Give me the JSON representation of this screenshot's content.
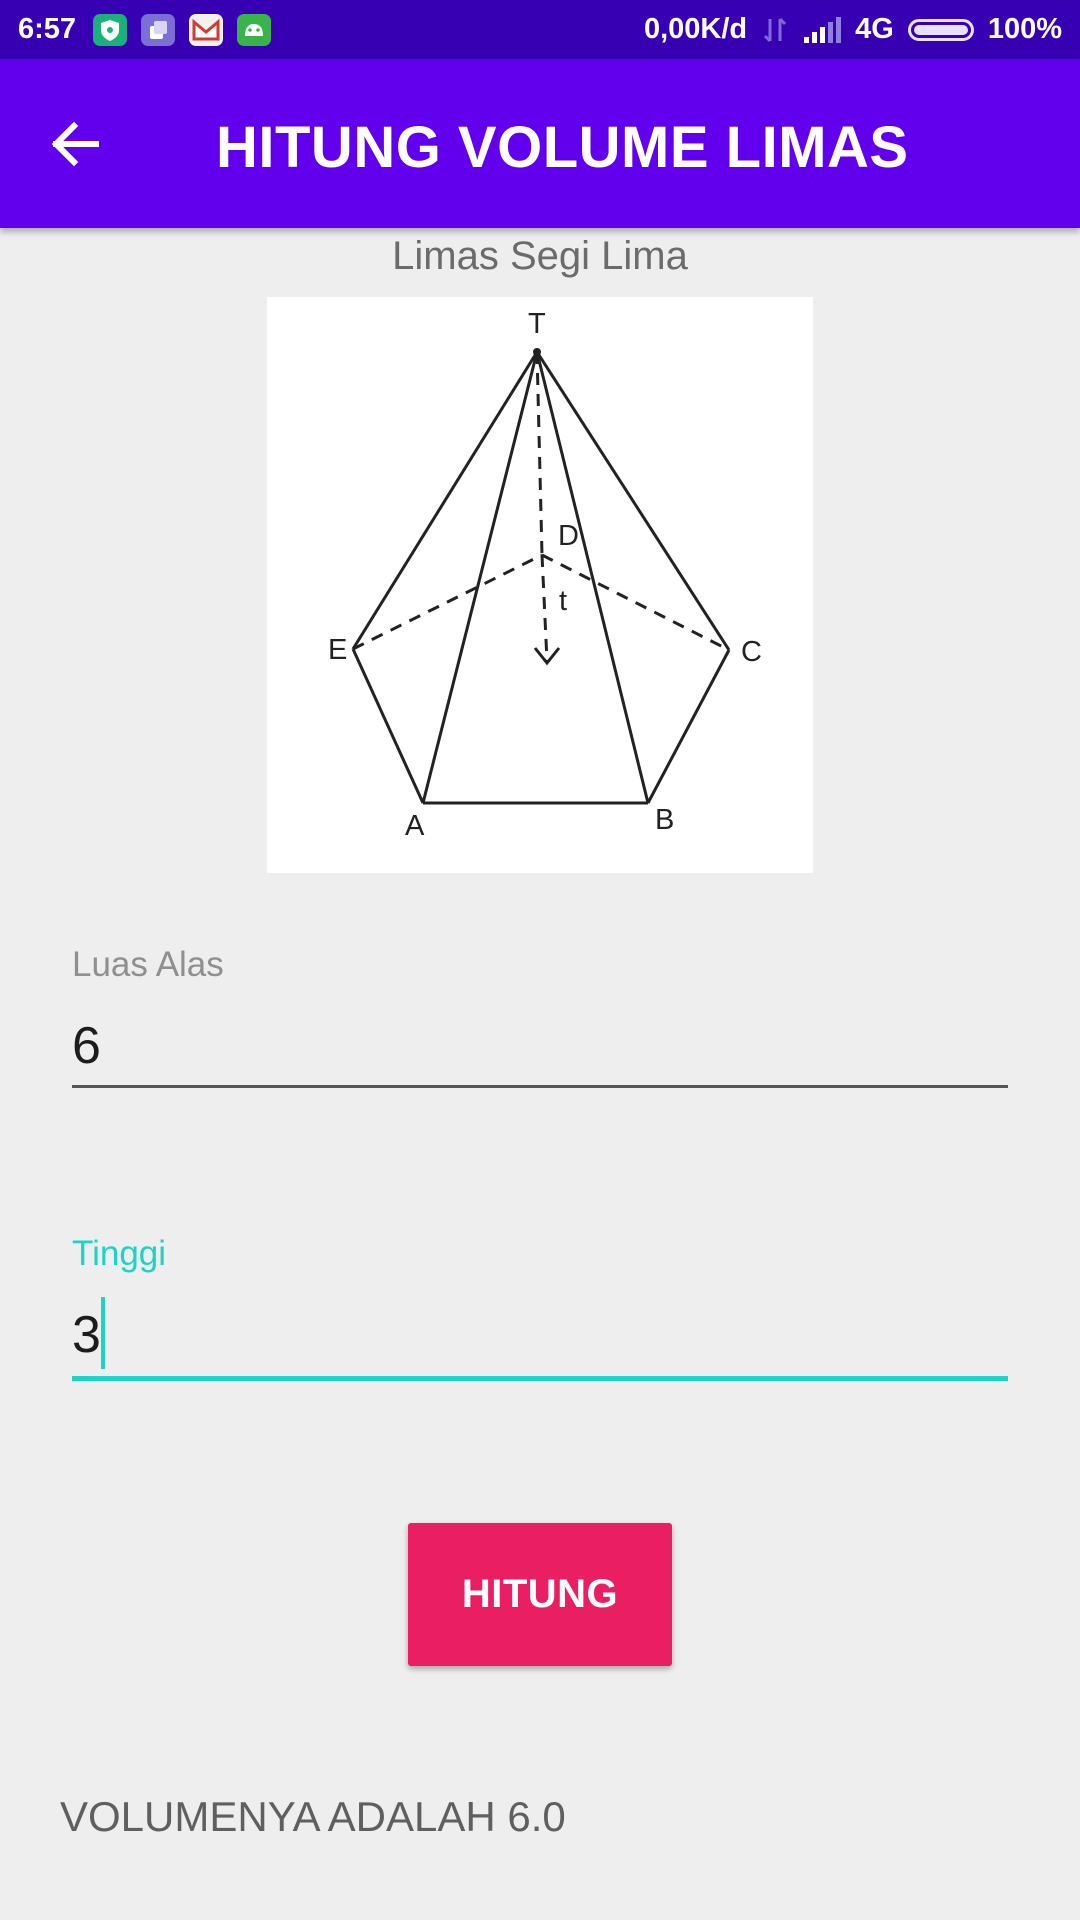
{
  "status_bar": {
    "time": "6:57",
    "network_speed": "0,00K/d",
    "network_type": "4G",
    "battery_text": "100%",
    "battery_level": 1.0,
    "notification_icons": [
      "shield-app-icon",
      "copy-app-icon",
      "gmail-icon",
      "android-icon"
    ]
  },
  "app_bar": {
    "title": "HITUNG VOLUME LIMAS",
    "back_icon": "arrow-left-icon"
  },
  "shape": {
    "label": "Limas Segi Lima",
    "diagram_points": {
      "apex": "T",
      "base_center": "D",
      "height": "t",
      "vertices": [
        "E",
        "C",
        "A",
        "B"
      ]
    }
  },
  "form": {
    "luas_alas": {
      "label": "Luas Alas",
      "value": "6"
    },
    "tinggi": {
      "label": "Tinggi",
      "value": "3"
    }
  },
  "button": {
    "label": "HITUNG"
  },
  "result": {
    "text": "VOLUMENYA ADALAH 6.0"
  },
  "colors": {
    "status_bar": "#3700b3",
    "app_bar": "#6200ee",
    "accent": "#1dd4c4",
    "button": "#e91e63",
    "background": "#eeeeee"
  }
}
